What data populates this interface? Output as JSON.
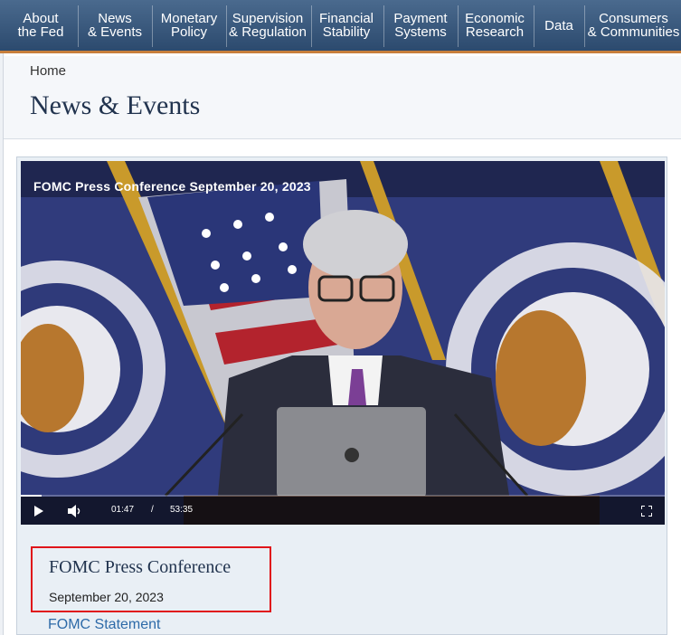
{
  "nav": {
    "items": [
      {
        "label": "About\nthe Fed"
      },
      {
        "label": "News\n& Events"
      },
      {
        "label": "Monetary\nPolicy"
      },
      {
        "label": "Supervision\n& Regulation"
      },
      {
        "label": "Financial\nStability"
      },
      {
        "label": "Payment\nSystems"
      },
      {
        "label": "Economic\nResearch"
      },
      {
        "label": "Data"
      },
      {
        "label": "Consumers\n& Communities"
      }
    ]
  },
  "breadcrumb": {
    "home": "Home"
  },
  "page": {
    "title": "News & Events"
  },
  "video": {
    "overlay_title": "FOMC Press Conference September 20, 2023",
    "current_time": "01:47",
    "separator": "/",
    "duration": "53:35",
    "progress_fraction": 0.033
  },
  "featured": {
    "title": "FOMC Press Conference",
    "date": "September 20, 2023",
    "link": "FOMC Statement"
  },
  "colors": {
    "nav_bg": "#34557a",
    "nav_accent": "#c87f3c",
    "highlight_box": "#e0141a",
    "link": "#2d6aa8"
  }
}
